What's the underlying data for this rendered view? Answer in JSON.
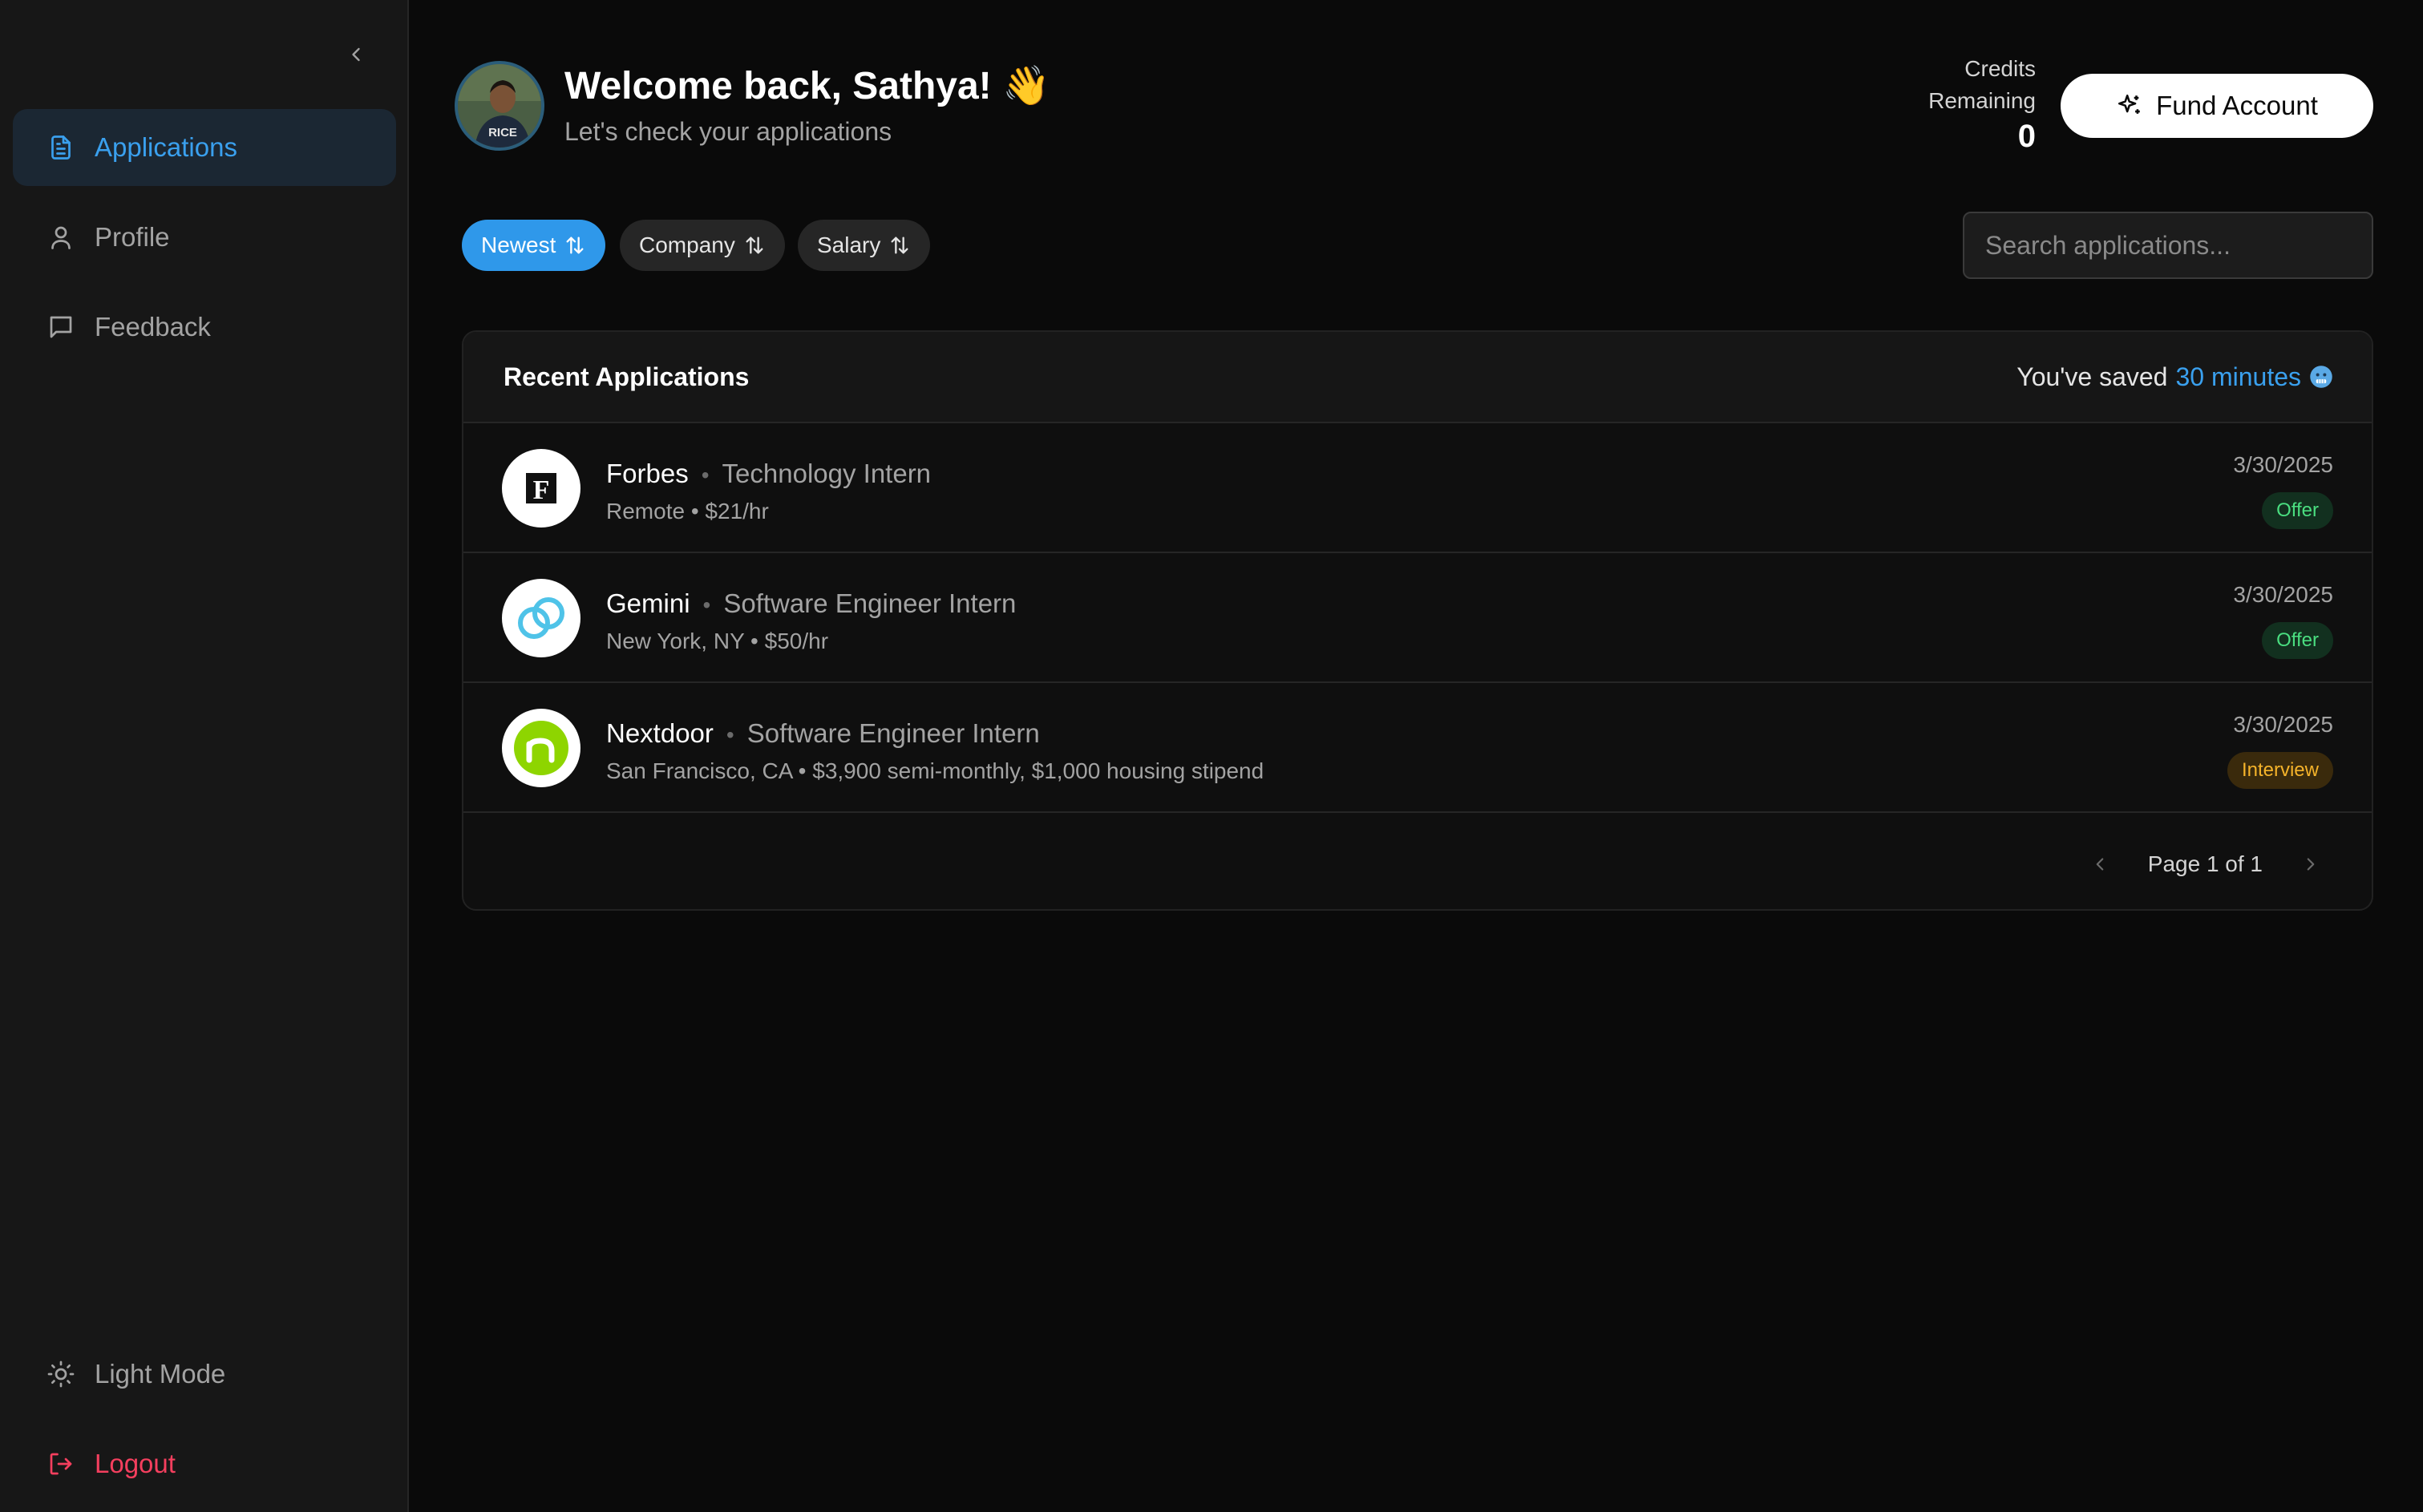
{
  "sidebar": {
    "items": [
      {
        "label": "Applications",
        "icon": "document-icon",
        "active": true
      },
      {
        "label": "Profile",
        "icon": "user-icon"
      },
      {
        "label": "Feedback",
        "icon": "message-icon"
      }
    ],
    "bottom": {
      "light_mode": "Light Mode",
      "logout": "Logout"
    }
  },
  "header": {
    "welcome": "Welcome back, Sathya! 👋",
    "subtitle": "Let's check your applications",
    "credits_label_1": "Credits",
    "credits_label_2": "Remaining",
    "credits_value": "0",
    "fund_button": "Fund Account"
  },
  "filters": {
    "items": [
      {
        "label": "Newest",
        "active": true
      },
      {
        "label": "Company"
      },
      {
        "label": "Salary"
      }
    ],
    "search_placeholder": "Search applications..."
  },
  "card": {
    "title": "Recent Applications",
    "saved_prefix": "You've saved",
    "saved_value": "30 minutes",
    "rows": [
      {
        "company": "Forbes",
        "role": "Technology Intern",
        "location": "Remote",
        "pay": "$21/hr",
        "date": "3/30/2025",
        "status": "Offer"
      },
      {
        "company": "Gemini",
        "role": "Software Engineer Intern",
        "location": "New York, NY",
        "pay": "$50/hr",
        "date": "3/30/2025",
        "status": "Offer"
      },
      {
        "company": "Nextdoor",
        "role": "Software Engineer Intern",
        "location": "San Francisco, CA",
        "pay": "$3,900 semi-monthly, $1,000 housing stipend",
        "date": "3/30/2025",
        "status": "Interview"
      }
    ],
    "pager": "Page 1 of 1"
  },
  "colors": {
    "accent": "#3aa0ee",
    "logout": "#f43f5e",
    "offer": "#4ade80",
    "interview": "#f5b32a"
  }
}
